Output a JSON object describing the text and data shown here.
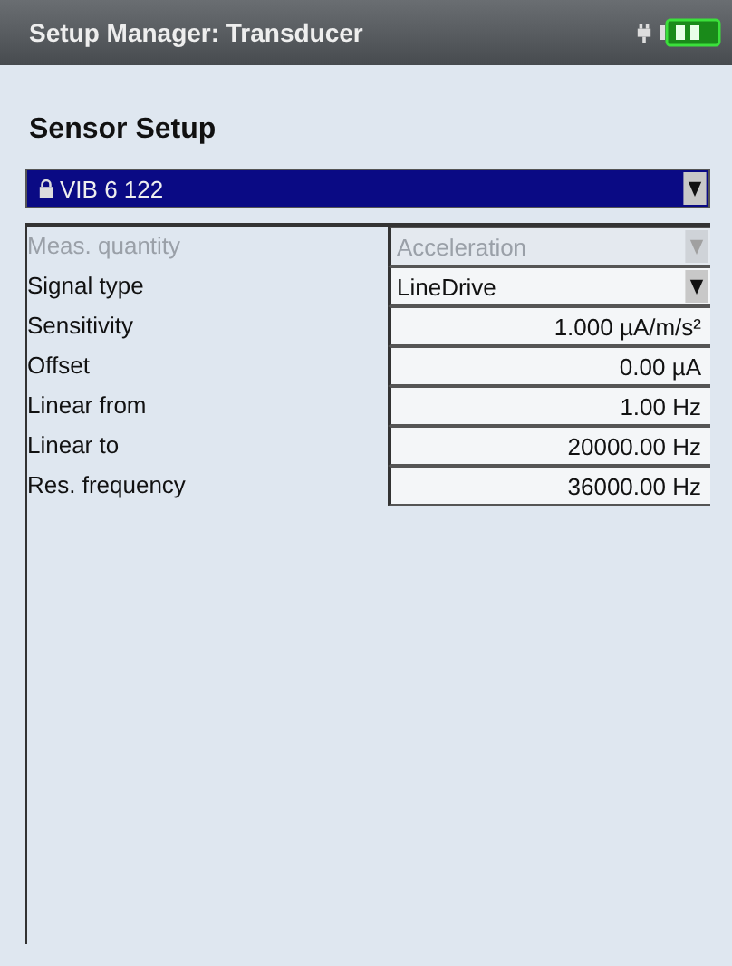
{
  "window": {
    "title": "Setup Manager: Transducer"
  },
  "heading": "Sensor Setup",
  "sensor": {
    "value": "VIB 6 122",
    "locked": true
  },
  "fields": [
    {
      "label": "Meas. quantity",
      "kind": "dropdown",
      "value": "Acceleration",
      "disabled": true
    },
    {
      "label": "Signal type",
      "kind": "dropdown",
      "value": "LineDrive",
      "disabled": false
    },
    {
      "label": "Sensitivity",
      "kind": "value",
      "value": "1.000 µA/m/s²",
      "disabled": false
    },
    {
      "label": "Offset",
      "kind": "value",
      "value": "0.00 µA",
      "disabled": false
    },
    {
      "label": "Linear from",
      "kind": "value",
      "value": "1.00 Hz",
      "disabled": false
    },
    {
      "label": "Linear to",
      "kind": "value",
      "value": "20000.00 Hz",
      "disabled": false
    },
    {
      "label": "Res. frequency",
      "kind": "value",
      "value": "36000.00 Hz",
      "disabled": false
    }
  ]
}
